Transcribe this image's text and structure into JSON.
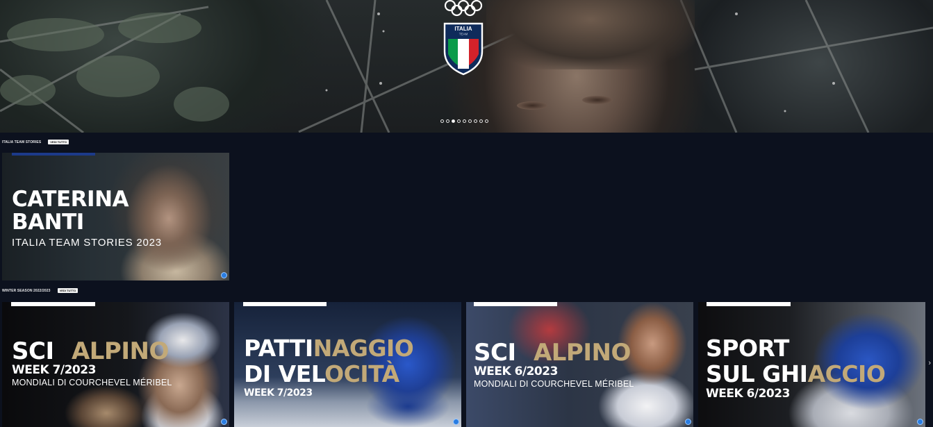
{
  "hero": {
    "logo": {
      "team_line1": "ITALIA",
      "team_line2": "TEAM"
    },
    "carousel": {
      "count": 9,
      "active_index": 3
    }
  },
  "sections": [
    {
      "title": "ITALIA TEAM STORIES",
      "see_all": "VEDI TUTTO",
      "cards": [
        {
          "line1": "CATERINA",
          "line2": "BANTI",
          "subtitle": "ITALIA TEAM STORIES 2023"
        }
      ]
    },
    {
      "title": "WINTER SEASON 2022/2023",
      "see_all": "VEDI TUTTO",
      "cards": [
        {
          "word1": "SCI",
          "word2": "ALPINO",
          "week": "WEEK 7/2023",
          "subtitle": "MONDIALI DI COURCHEVEL MÉRIBEL"
        },
        {
          "line1a": "PATTI",
          "line1b": "NAGGIO",
          "line2a": "DI VEL",
          "line2b": "OCITÀ",
          "week": "WEEK 7/2023"
        },
        {
          "word1": "SCI",
          "word2": "ALPINO",
          "week": "WEEK 6/2023",
          "subtitle": "MONDIALI DI COURCHEVEL MÉRIBEL"
        },
        {
          "line1a": "SPORT",
          "line2a": "SUL GHI",
          "line2b": "ACCIO",
          "week": "WEEK 6/2023"
        }
      ]
    }
  ],
  "colors": {
    "background": "#0c111e",
    "accent_gold": "#c2a978",
    "badge_blue": "#2a7de1"
  },
  "icons": {
    "next": "chevron-right-icon",
    "badge": "play-badge-icon"
  }
}
